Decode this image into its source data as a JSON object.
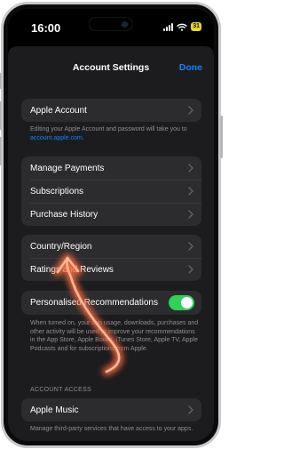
{
  "status_bar": {
    "time": "16:00",
    "battery": "31"
  },
  "nav": {
    "title": "Account Settings",
    "done_label": "Done"
  },
  "apple_account": {
    "label": "Apple Account",
    "footnote_text": "Editing your Apple Account and password will take you to ",
    "footnote_link": "account.apple.com",
    "footnote_end": "."
  },
  "payments_group": {
    "items": [
      {
        "label": "Manage Payments"
      },
      {
        "label": "Subscriptions"
      },
      {
        "label": "Purchase History"
      }
    ]
  },
  "region_group": {
    "items": [
      {
        "label": "Country/Region"
      },
      {
        "label": "Ratings and Reviews"
      }
    ]
  },
  "recommendations": {
    "label": "Personalised Recommendations",
    "enabled": true,
    "footnote": "When turned on, your app usage, downloads, purchases and other activity will be used to improve your recommendations in the App Store, Apple Books, iTunes Store, Apple TV, Apple Podcasts and for subscriptions from Apple."
  },
  "account_access": {
    "header": "ACCOUNT ACCESS",
    "item_label": "Apple Music",
    "footnote": "Manage third-party services that have access to your apps."
  },
  "colors": {
    "accent": "#0a84ff",
    "toggle_on": "#30d158",
    "gesture": "#ff8a5c"
  },
  "icons": [
    "chevron-right-icon",
    "signal-icon",
    "wifi-icon",
    "battery-icon",
    "swipe-gesture-arrow"
  ]
}
